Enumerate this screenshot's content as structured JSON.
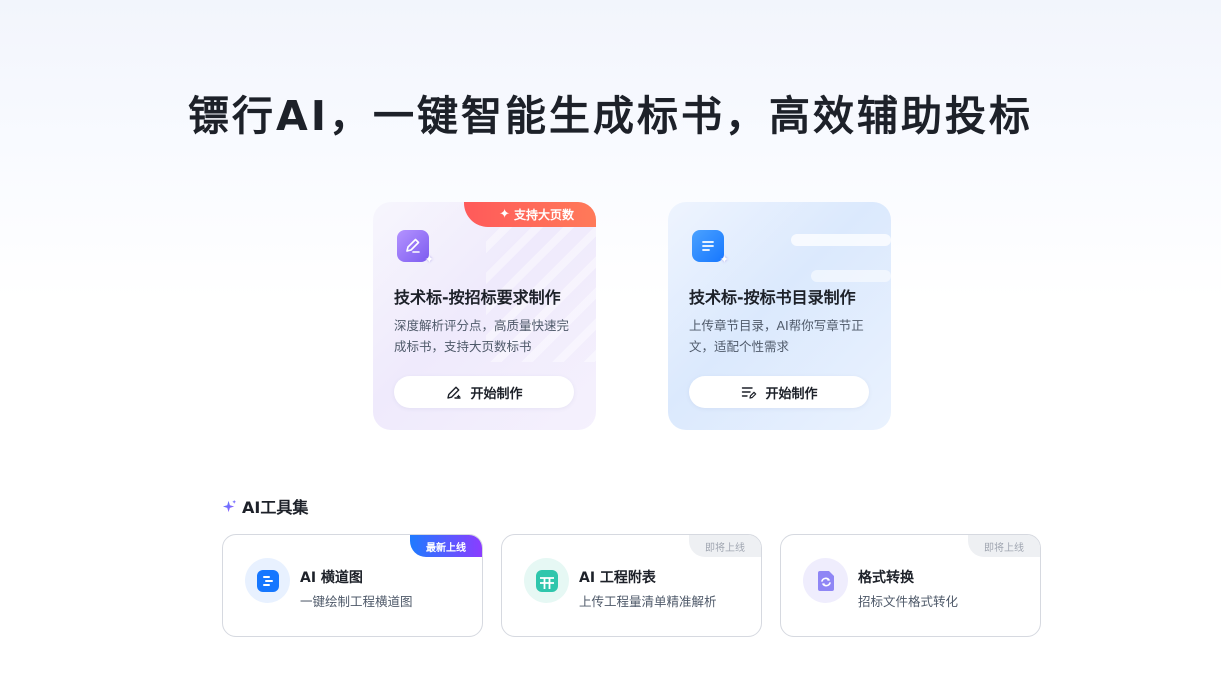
{
  "hero": {
    "title": "镖行AI，一键智能生成标书，高效辅助投标"
  },
  "cards": [
    {
      "badge": "支持大页数",
      "title": "技术标-按招标要求制作",
      "description": "深度解析评分点，高质量快速完成标书，支持大页数标书",
      "button": "开始制作",
      "icon": "pen-edit-icon",
      "accent": "#7d5cf0"
    },
    {
      "title": "技术标-按标书目录制作",
      "description": "上传章节目录，AI帮你写章节正文，适配个性需求",
      "button": "开始制作",
      "icon": "document-list-icon",
      "accent": "#1677ff"
    }
  ],
  "tools_section": {
    "title": "AI工具集",
    "icon": "sparkle-icon"
  },
  "tools": [
    {
      "badge": "最新上线",
      "title": "AI 横道图",
      "description": "一键绘制工程横道图",
      "icon": "gantt-icon",
      "icon_color": "#1677ff",
      "icon_bg": "#e8f1ff"
    },
    {
      "badge": "即将上线",
      "title": "AI 工程附表",
      "description": "上传工程量清单精准解析",
      "icon": "table-icon",
      "icon_color": "#2fc6ac",
      "icon_bg": "#e6f8f4"
    },
    {
      "badge": "即将上线",
      "title": "格式转换",
      "description": "招标文件格式转化",
      "icon": "file-convert-icon",
      "icon_color": "#8f86f5",
      "icon_bg": "#efedfd"
    }
  ],
  "colors": {
    "badge_hot": "#ff5a5a",
    "badge_new_start": "#1f7bff",
    "badge_new_end": "#8b3dff",
    "badge_soon_bg": "#eef0f3"
  }
}
